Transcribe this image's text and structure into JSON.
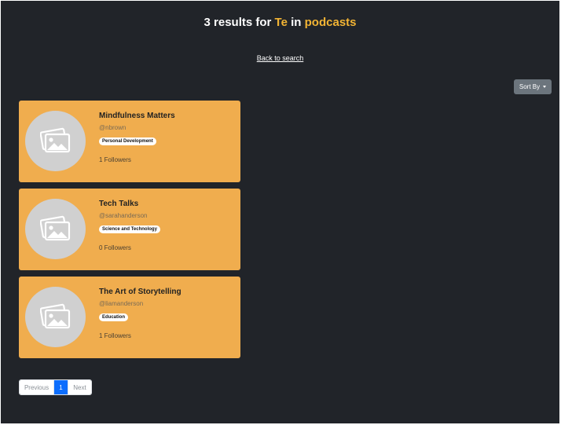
{
  "header": {
    "count_text": "3 results for",
    "query": "Te",
    "in_text": "in",
    "category": "podcasts"
  },
  "back_link": "Back to search",
  "sort_button": {
    "label": "Sort By"
  },
  "results": [
    {
      "title": "Mindfulness Matters",
      "handle": "@nbrown",
      "category": "Personal Development",
      "followers": "1 Followers"
    },
    {
      "title": "Tech Talks",
      "handle": "@sarahanderson",
      "category": "Science and Technology",
      "followers": "0 Followers"
    },
    {
      "title": "The Art of Storytelling",
      "handle": "@liamanderson",
      "category": "Education",
      "followers": "1 Followers"
    }
  ],
  "pagination": {
    "previous": "Previous",
    "current": "1",
    "next": "Next"
  },
  "colors": {
    "background": "#212429",
    "accent": "#f2b434",
    "card": "#f0ad4e",
    "active_page": "#0d6efd"
  }
}
